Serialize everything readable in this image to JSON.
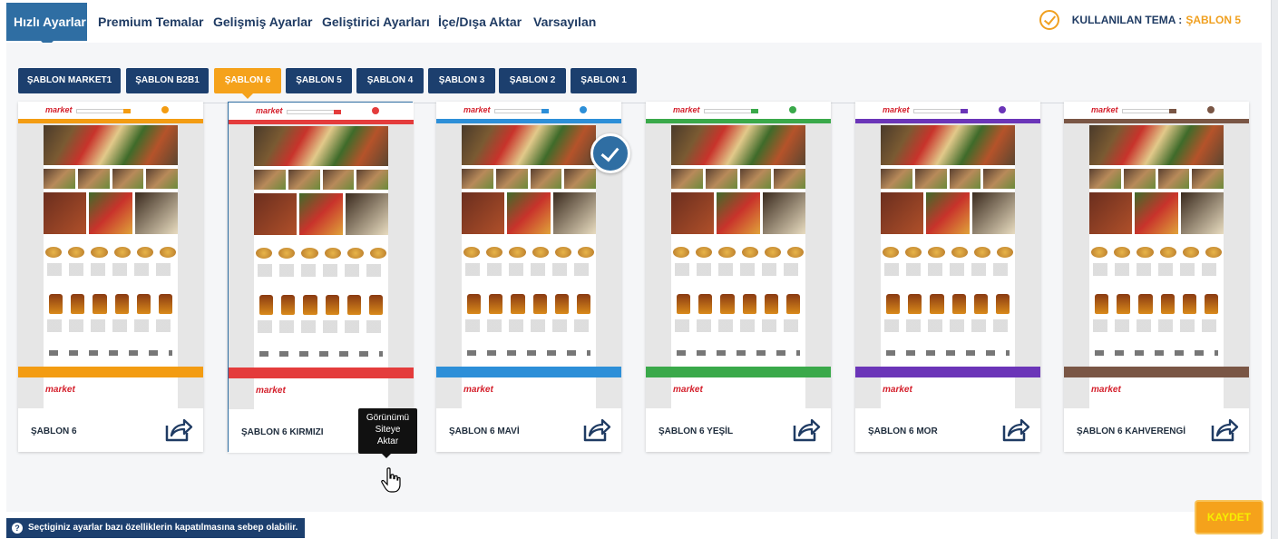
{
  "tabs": [
    {
      "label": "Hızlı Ayarlar"
    },
    {
      "label": "Premium Temalar"
    },
    {
      "label": "Gelişmiş Ayarlar"
    },
    {
      "label": "Geliştirici Ayarları"
    },
    {
      "label": "İçe/Dışa Aktar"
    },
    {
      "label": "Varsayılan"
    }
  ],
  "current_theme": {
    "label": "KULLANILAN TEMA :",
    "value": "ŞABLON 5"
  },
  "template_tabs": [
    {
      "label": "ŞABLON MARKET1"
    },
    {
      "label": "ŞABLON B2B1"
    },
    {
      "label": "ŞABLON 6"
    },
    {
      "label": "ŞABLON 5"
    },
    {
      "label": "ŞABLON 4"
    },
    {
      "label": "ŞABLON 3"
    },
    {
      "label": "ŞABLON 2"
    },
    {
      "label": "ŞABLON 1"
    }
  ],
  "cards": [
    {
      "title": "ŞABLON 6",
      "color": "#f39c12"
    },
    {
      "title": "ŞABLON 6 KIRMIZI",
      "color": "#e43c3c"
    },
    {
      "title": "ŞABLON 6 MAVİ",
      "color": "#2d8fd8"
    },
    {
      "title": "ŞABLON 6 YEŞİL",
      "color": "#3aa94a"
    },
    {
      "title": "ŞABLON 6 MOR",
      "color": "#6b35b8"
    },
    {
      "title": "ŞABLON 6 KAHVERENGİ",
      "color": "#7a5645"
    }
  ],
  "thumb_logo": "market",
  "tooltip": {
    "line1": "Görünümü",
    "line2": "Siteye",
    "line3": "Aktar"
  },
  "notice": "Seçtiginiz ayarlar bazı özelliklerin kapatılmasına sebep olabilir.",
  "save_label": "KAYDET",
  "colors": {
    "primary": "#1c3f6e",
    "accent": "#f5a21b",
    "tab_active": "#2f6ea3"
  }
}
